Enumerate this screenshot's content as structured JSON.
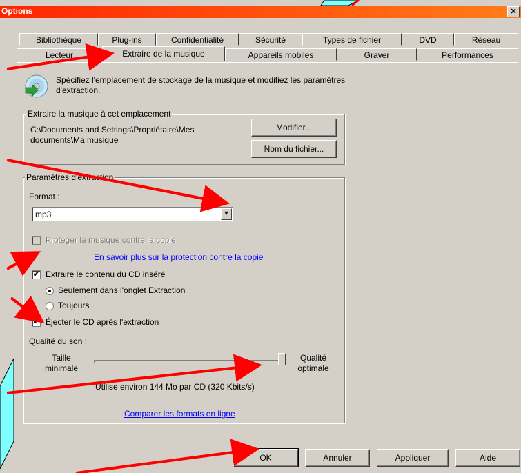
{
  "window": {
    "title": "Options",
    "close_glyph": "✕"
  },
  "tabs_row1": [
    "Bibliothèque",
    "Plug-ins",
    "Confidentialité",
    "Sécurité",
    "Types de fichier",
    "DVD",
    "Réseau"
  ],
  "tabs_row2": [
    "Lecteur",
    "Extraire de la musique",
    "Appareils mobiles",
    "Graver",
    "Performances"
  ],
  "active_tab": "Extraire de la musique",
  "header": {
    "icon": "cd-rip-icon",
    "description": "Spécifiez l'emplacement de stockage de la musique et modifiez les paramètres d'extraction."
  },
  "location_group": {
    "label": "Extraire la musique à cet emplacement",
    "path": "C:\\Documents and Settings\\Propriétaire\\Mes documents\\Ma musique",
    "modify_button": "Modifier...",
    "filename_button": "Nom du fichier..."
  },
  "settings_group": {
    "label": "Paramètres d'extraction",
    "format_label": "Format :",
    "format_value": "mp3",
    "copy_protect_label": "Protéger la musique contre la copie",
    "copy_protect_checked": false,
    "copy_protect_enabled": false,
    "learn_more_link": "En savoir plus sur la protection contre la copie",
    "rip_cd_label": "Extraire le contenu du CD inséré",
    "rip_cd_checked": true,
    "radio_only_tab": "Seulement dans l'onglet Extraction",
    "radio_always": "Toujours",
    "radio_selected": "only_tab",
    "eject_label": "Éjecter le CD après l'extraction",
    "eject_checked": true,
    "quality_label": "Qualité du son :",
    "quality_min_label": "Taille minimale",
    "quality_max_label": "Qualité optimale",
    "quality_level": 1.0,
    "usage_text": "Utilise environ 144 Mo par CD (320 Kbits/s)",
    "compare_link": "Comparer les formats en ligne"
  },
  "footer_buttons": {
    "ok": "OK",
    "cancel": "Annuler",
    "apply": "Appliquer",
    "help": "Aide"
  },
  "colors": {
    "title_start": "#ff2400",
    "title_end": "#ff7e1a",
    "annotation_arrow": "#ff0000",
    "deco_cyan": "#7fffff"
  }
}
